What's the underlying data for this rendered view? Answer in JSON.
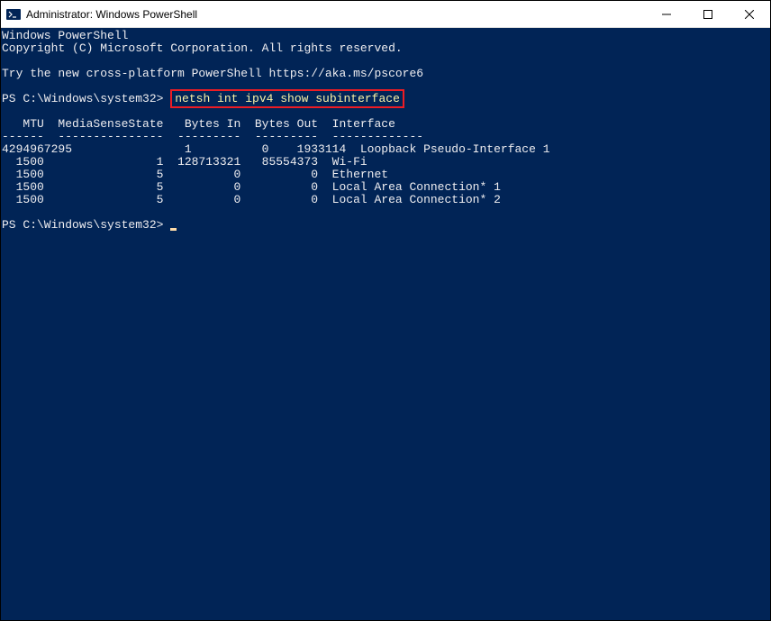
{
  "titlebar": {
    "title": "Administrator: Windows PowerShell"
  },
  "terminal": {
    "header_line1": "Windows PowerShell",
    "header_line2": "Copyright (C) Microsoft Corporation. All rights reserved.",
    "try_line": "Try the new cross-platform PowerShell https://aka.ms/pscore6",
    "prompt1": "PS C:\\Windows\\system32> ",
    "command": "netsh int ipv4 show subinterface",
    "tbl_header": "   MTU  MediaSenseState   Bytes In  Bytes Out  Interface",
    "tbl_divider": "------  ---------------  ---------  ---------  -------------",
    "row1": "4294967295                1          0    1933114  Loopback Pseudo-Interface 1",
    "row2": "  1500                1  128713321   85554373  Wi-Fi",
    "row3": "  1500                5          0          0  Ethernet",
    "row4": "  1500                5          0          0  Local Area Connection* 1",
    "row5": "  1500                5          0          0  Local Area Connection* 2",
    "prompt2": "PS C:\\Windows\\system32> "
  }
}
